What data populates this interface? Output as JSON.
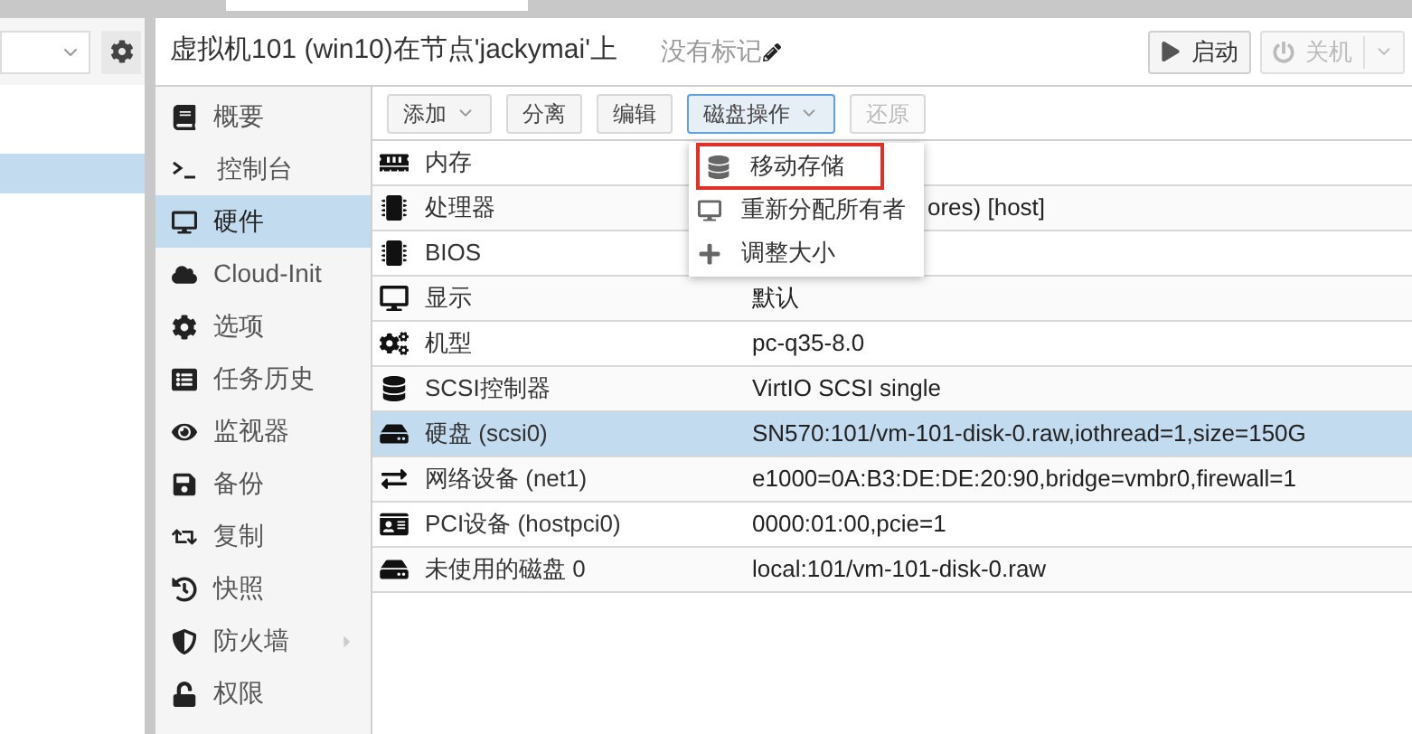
{
  "header": {
    "title": "虚拟机101 (win10)在节点'jackymai'上",
    "tags": "没有标记",
    "buttons": [
      {
        "label": "启动",
        "disabled": false,
        "kind": "start"
      },
      {
        "label": "关机",
        "disabled": true,
        "kind": "shutdown"
      }
    ]
  },
  "nav": [
    {
      "label": "概要",
      "selected": false,
      "expandable": false
    },
    {
      "label": "控制台",
      "selected": false,
      "expandable": false
    },
    {
      "label": "硬件",
      "selected": true,
      "expandable": false
    },
    {
      "label": "Cloud-Init",
      "selected": false,
      "expandable": false
    },
    {
      "label": "选项",
      "selected": false,
      "expandable": false
    },
    {
      "label": "任务历史",
      "selected": false,
      "expandable": false
    },
    {
      "label": "监视器",
      "selected": false,
      "expandable": false
    },
    {
      "label": "备份",
      "selected": false,
      "expandable": false
    },
    {
      "label": "复制",
      "selected": false,
      "expandable": false
    },
    {
      "label": "快照",
      "selected": false,
      "expandable": false
    },
    {
      "label": "防火墙",
      "selected": false,
      "expandable": true
    },
    {
      "label": "权限",
      "selected": false,
      "expandable": false
    }
  ],
  "toolbar": [
    {
      "label": "添加",
      "dropdown": true,
      "disabled": false,
      "pressed": false
    },
    {
      "label": "分离",
      "dropdown": false,
      "disabled": false,
      "pressed": false
    },
    {
      "label": "编辑",
      "dropdown": false,
      "disabled": false,
      "pressed": false
    },
    {
      "label": "磁盘操作",
      "dropdown": true,
      "disabled": false,
      "pressed": true
    },
    {
      "label": "还原",
      "dropdown": false,
      "disabled": true,
      "pressed": false
    }
  ],
  "rows": [
    {
      "name": "内存",
      "selected": false
    },
    {
      "name": "处理器",
      "value": "ores) [host]",
      "selected": false
    },
    {
      "name": "BIOS",
      "selected": false
    },
    {
      "name": "显示",
      "value": "默认",
      "selected": false
    },
    {
      "name": "机型",
      "value": "pc-q35-8.0",
      "selected": false
    },
    {
      "name": "SCSI控制器",
      "value": "VirtIO SCSI single",
      "selected": false
    },
    {
      "name": "硬盘 (scsi0)",
      "value": "SN570:101/vm-101-disk-0.raw,iothread=1,size=150G",
      "selected": true
    },
    {
      "name": "网络设备 (net1)",
      "value": "e1000=0A:B3:DE:DE:20:90,bridge=vmbr0,firewall=1",
      "selected": false
    },
    {
      "name": "PCI设备 (hostpci0)",
      "value": "0000:01:00,pcie=1",
      "selected": false
    },
    {
      "name": "未使用的磁盘 0",
      "value": "local:101/vm-101-disk-0.raw",
      "selected": false
    }
  ],
  "menu": [
    {
      "label": "移动存储",
      "highlighted": true
    },
    {
      "label": "重新分配所有者",
      "highlighted": false
    },
    {
      "label": "调整大小",
      "highlighted": false
    }
  ]
}
